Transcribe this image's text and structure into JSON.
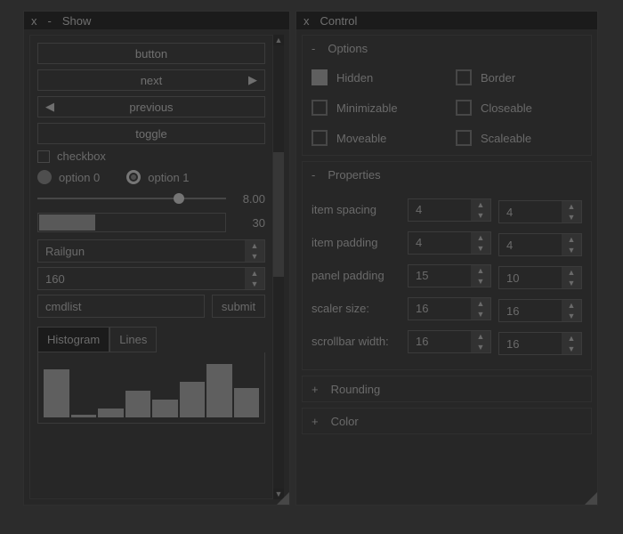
{
  "show": {
    "title": "Show",
    "close": "x",
    "min": "-",
    "btn_button": "button",
    "btn_next": "next",
    "btn_prev": "previous",
    "btn_toggle": "toggle",
    "checkbox_label": "checkbox",
    "radio0": "option 0",
    "radio1": "option 1",
    "slider_value": "8.00",
    "progress_value": "30",
    "combo_value": "Railgun",
    "spinner_value": "160",
    "cmd_placeholder": "cmdlist",
    "submit_label": "submit",
    "tab_hist": "Histogram",
    "tab_lines": "Lines"
  },
  "control": {
    "title": "Control",
    "close": "x",
    "sect_options": "Options",
    "sect_props": "Properties",
    "sect_rounding": "Rounding",
    "sect_color": "Color",
    "plus": "+",
    "minus": "-",
    "opt_hidden": "Hidden",
    "opt_border": "Border",
    "opt_minim": "Minimizable",
    "opt_close": "Closeable",
    "opt_move": "Moveable",
    "opt_scale": "Scaleable",
    "props": {
      "item_spacing": {
        "label": "item spacing",
        "a": "4",
        "b": "4"
      },
      "item_padding": {
        "label": "item padding",
        "a": "4",
        "b": "4"
      },
      "panel_padding": {
        "label": "panel padding",
        "a": "15",
        "b": "10"
      },
      "scaler_size": {
        "label": "scaler size:",
        "a": "16",
        "b": "16"
      },
      "scroll_w": {
        "label": "scrollbar width:",
        "a": "16",
        "b": "16"
      }
    }
  },
  "chart_data": {
    "type": "bar",
    "title": "Histogram",
    "values": [
      80,
      5,
      15,
      45,
      30,
      60,
      90,
      50
    ],
    "ylim": [
      0,
      100
    ]
  }
}
